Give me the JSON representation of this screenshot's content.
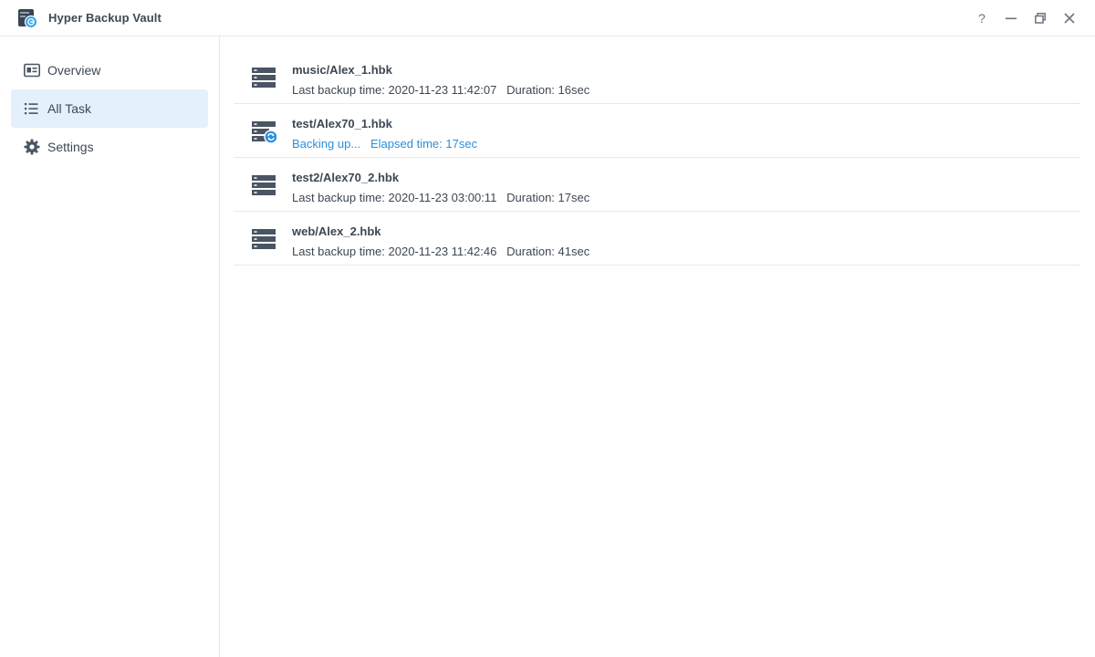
{
  "window": {
    "title": "Hyper Backup Vault",
    "controls": [
      "help-icon",
      "minimize-icon",
      "restore-icon",
      "close-icon"
    ],
    "help_label": "?"
  },
  "sidebar": {
    "items": [
      {
        "label": "Overview",
        "icon": "overview-icon",
        "active": false
      },
      {
        "label": "All Task",
        "icon": "list-icon",
        "active": true
      },
      {
        "label": "Settings",
        "icon": "gear-icon",
        "active": false
      }
    ]
  },
  "tasks": [
    {
      "name": "music/Alex_1.hbk",
      "status_label": "Last backup time:",
      "status_value": "2020-11-23 11:42:07",
      "extra_label": "Duration:",
      "extra_value": "16sec",
      "state": "idle",
      "icon": "server-icon"
    },
    {
      "name": "test/Alex70_1.hbk",
      "status_label": "Backing up...",
      "status_value": "",
      "extra_label": "Elapsed time:",
      "extra_value": "17sec",
      "state": "running",
      "icon": "server-sync-icon"
    },
    {
      "name": "test2/Alex70_2.hbk",
      "status_label": "Last backup time:",
      "status_value": "2020-11-23 03:00:11",
      "extra_label": "Duration:",
      "extra_value": "17sec",
      "state": "idle",
      "icon": "server-icon"
    },
    {
      "name": "web/Alex_2.hbk",
      "status_label": "Last backup time:",
      "status_value": "2020-11-23 11:42:46",
      "extra_label": "Duration:",
      "extra_value": "41sec",
      "state": "idle",
      "icon": "server-icon"
    }
  ],
  "colors": {
    "accent": "#2a8fdb",
    "active_nav_bg": "#e4f0fb",
    "text": "#3d4753",
    "divider": "#e6e9ee",
    "icon_dark": "#4a5563"
  }
}
